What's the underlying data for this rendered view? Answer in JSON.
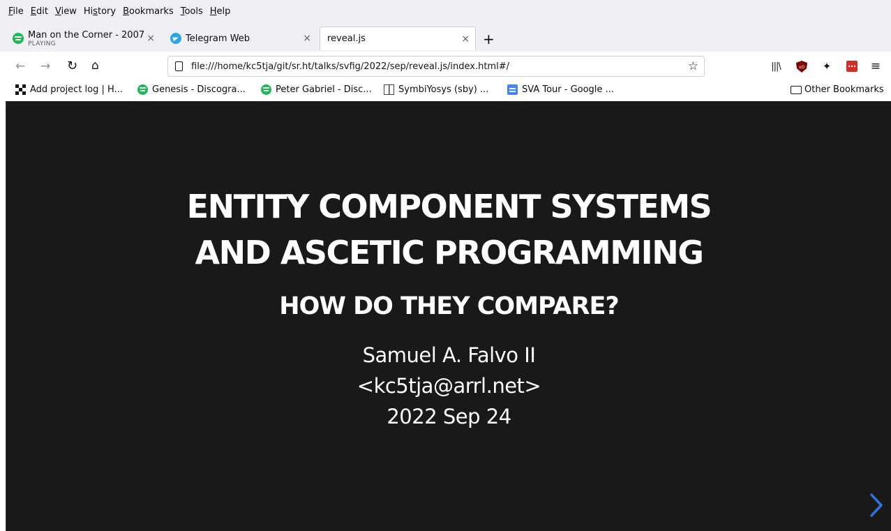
{
  "menubar": {
    "items": [
      {
        "accel": "F",
        "rest": "ile"
      },
      {
        "accel": "E",
        "rest": "dit"
      },
      {
        "accel": "V",
        "rest": "iew"
      },
      {
        "pre": "Hi",
        "accel": "s",
        "rest": "tory"
      },
      {
        "accel": "B",
        "rest": "ookmarks"
      },
      {
        "accel": "T",
        "rest": "ools"
      },
      {
        "accel": "H",
        "rest": "elp"
      }
    ]
  },
  "tabs": [
    {
      "title": "Man on the Corner - 2007",
      "subtitle": "PLAYING",
      "icon": "spotify-icon"
    },
    {
      "title": "Telegram Web",
      "icon": "telegram-icon"
    },
    {
      "title": "reveal.js",
      "active": true
    }
  ],
  "close_glyph": "×",
  "new_tab_glyph": "+",
  "navbar": {
    "url": "file:///home/kc5tja/git/sr.ht/talks/svfig/2022/sep/reveal.js/index.html#/"
  },
  "bookmarks": {
    "items": [
      {
        "label": "Add project log | H...",
        "icon": "qr-icon"
      },
      {
        "label": "Genesis - Discogra...",
        "icon": "spotify-icon"
      },
      {
        "label": "Peter Gabriel - Disc...",
        "icon": "spotify-icon"
      },
      {
        "label": "SymbiYosys (sby) ...",
        "icon": "book-icon"
      },
      {
        "label": "SVA Tour - Google ...",
        "icon": "google-docs-icon"
      }
    ],
    "other": "Other Bookmarks"
  },
  "slide": {
    "title_line1": "ENTITY COMPONENT SYSTEMS",
    "title_line2": "AND ASCETIC PROGRAMMING",
    "subtitle": "HOW DO THEY COMPARE?",
    "author": "Samuel A. Falvo II",
    "email": "<kc5tja@arrl.net>",
    "date": "2022 Sep 24"
  },
  "colors": {
    "slide_bg": "#191919",
    "accent": "#2a76dd"
  }
}
